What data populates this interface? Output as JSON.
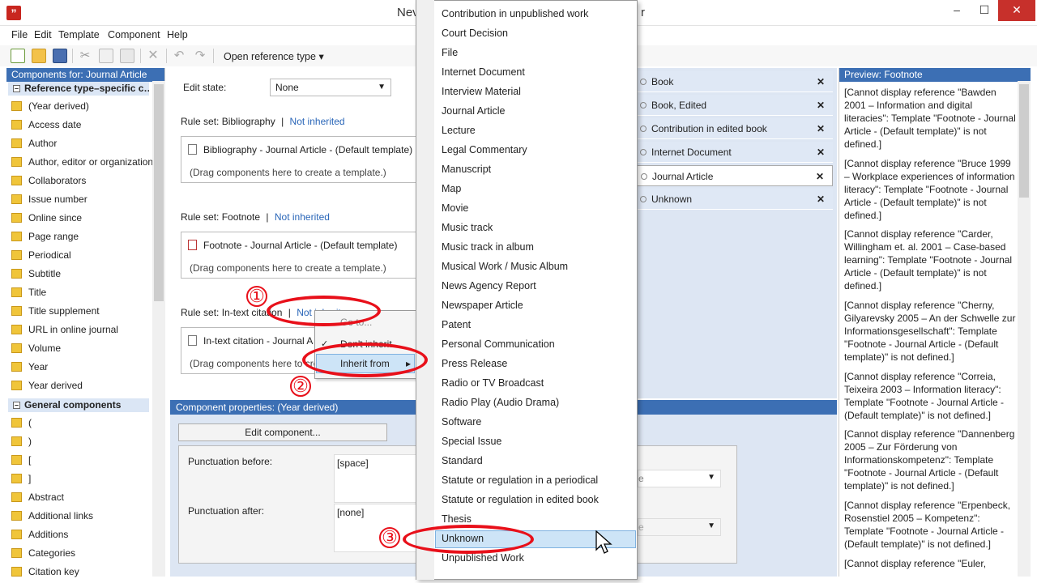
{
  "window": {
    "title_visible": "Nev",
    "title_tail": "r"
  },
  "menu": [
    "File",
    "Edit",
    "Template",
    "Component",
    "Help"
  ],
  "toolbar": {
    "open_ref_type": "Open reference type"
  },
  "left_panel": {
    "header": "Components for: Journal Article",
    "group1": "Reference type–specific c…",
    "items1": [
      "(Year derived)",
      "Access date",
      "Author",
      "Author, editor or organization",
      "Collaborators",
      "Issue number",
      "Online since",
      "Page range",
      "Periodical",
      "Subtitle",
      "Title",
      "Title supplement",
      "URL in online journal",
      "Volume",
      "Year",
      "Year derived"
    ],
    "group2": "General components",
    "items2": [
      "(",
      ")",
      "[",
      "]",
      "Abstract",
      "Additional links",
      "Additions",
      "Categories",
      "Citation key"
    ]
  },
  "center": {
    "edit_state_label": "Edit state:",
    "edit_state_value": "None",
    "rule_bib": "Rule set: Bibliography",
    "rule_foot": "Rule set: Footnote",
    "rule_intext": "Rule set: In-text citation",
    "sep": "|",
    "not_inherited": "Not inherited",
    "not_inherited_partial": "Not inherit",
    "tpl_bib": "Bibliography - Journal Article - (Default template)",
    "tpl_foot": "Footnote - Journal Article - (Default template)",
    "tpl_intext": "In-text citation - Journal A",
    "drag_hint": "(Drag components here to create a template.)",
    "drag_hint_partial": "(Drag components here to cre"
  },
  "context_menu": {
    "goto": "Go to...",
    "dont_inherit": "Don't inherit",
    "inherit_from": "Inherit from",
    "check": "✓",
    "arrow": "▸"
  },
  "properties": {
    "header": "Component properties:  (Year derived)",
    "edit_btn": "Edit component...",
    "punct_before": "Punctuation before:",
    "punct_before_val": "[space]",
    "punct_after": "Punctuation after:",
    "punct_after_val": "[none]",
    "combo_partial": "e"
  },
  "ref_list": [
    {
      "label": "Book",
      "selected": false
    },
    {
      "label": "Book, Edited",
      "selected": false
    },
    {
      "label": "Contribution in edited book",
      "selected": false
    },
    {
      "label": "Internet Document",
      "selected": false
    },
    {
      "label": "Journal Article",
      "selected": true
    },
    {
      "label": "Unknown",
      "selected": false
    }
  ],
  "preview": {
    "header": "Preview: Footnote",
    "entries": [
      "[Cannot display reference \"Bawden 2001 – Information and digital literacies\": Template \"Footnote - Journal Article - (Default template)\" is not defined.]",
      "[Cannot display reference \"Bruce 1999 – Workplace experiences of information literacy\": Template \"Footnote - Journal Article - (Default template)\" is not defined.]",
      "[Cannot display reference \"Carder, Willingham et. al. 2001 – Case-based learning\": Template \"Footnote - Journal Article - (Default template)\" is not defined.]",
      "[Cannot display reference \"Cherny, Gilyarevsky 2005 – An der Schwelle zur Informationsgesellschaft\": Template \"Footnote - Journal Article - (Default template)\" is not defined.]",
      "[Cannot display reference \"Correia, Teixeira 2003 – Information literacy\": Template \"Footnote - Journal Article - (Default template)\" is not defined.]",
      "[Cannot display reference \"Dannenberg 2005 – Zur Förderung von Informationskompetenz\": Template \"Footnote - Journal Article - (Default template)\" is not defined.]",
      "[Cannot display reference \"Erpenbeck, Rosenstiel 2005 – Kompetenz\": Template \"Footnote - Journal Article - (Default template)\" is not defined.]",
      "[Cannot display reference \"Euler,"
    ]
  },
  "dropdown_items": [
    "Contribution in unpublished work",
    "Court Decision",
    "File",
    "Internet Document",
    "Interview Material",
    "Journal Article",
    "Lecture",
    "Legal Commentary",
    "Manuscript",
    "Map",
    "Movie",
    "Music track",
    "Music track in album",
    "Musical Work / Music Album",
    "News Agency Report",
    "Newspaper Article",
    "Patent",
    "Personal Communication",
    "Press Release",
    "Radio or TV Broadcast",
    "Radio Play (Audio Drama)",
    "Software",
    "Special Issue",
    "Standard",
    "Statute or regulation in a periodical",
    "Statute or regulation in edited book",
    "Thesis",
    "Unknown",
    "Unpublished Work"
  ],
  "annotations": {
    "n1": "①",
    "n2": "②",
    "n3": "③"
  },
  "colors": {
    "accent": "#3c6fb4",
    "annotation_red": "#e8101a",
    "highlight": "#cde4f7"
  }
}
